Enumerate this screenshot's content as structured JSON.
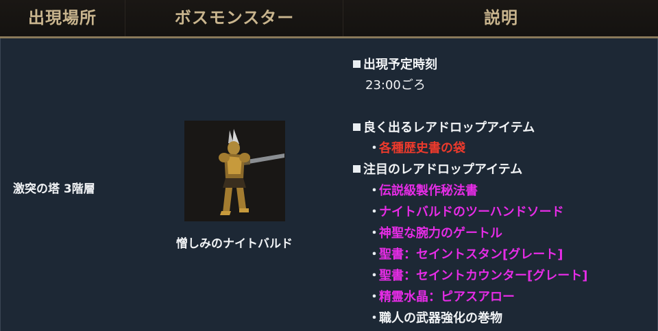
{
  "header": {
    "col_location": "出現場所",
    "col_boss": "ボスモンスター",
    "col_desc": "説明"
  },
  "row": {
    "location": "激突の塔 3階層",
    "boss_name": "憎しみのナイトバルド",
    "boss_image_icon": "knight-boss-portrait"
  },
  "description": {
    "time_heading": "出現予定時刻",
    "time_value": "23:00ごろ",
    "common_drop_heading": "良く出るレアドロップアイテム",
    "common_drops": [
      "各種歴史書の袋"
    ],
    "notable_drop_heading": "注目のレアドロップアイテム",
    "notable_drops": [
      "伝説級製作秘法書",
      "ナイトバルドのツーハンドソード",
      "神聖な腕力のゲートル",
      "聖書：セイントスタン[グレート]",
      "聖書：セイントカウンター[グレート]",
      "精霊水晶：ピアスアロー",
      "職人の武器強化の巻物"
    ]
  },
  "colors": {
    "header_text": "#c9b58e",
    "common_drop": "#ec3a2c",
    "notable_drop": "#e62ce6",
    "background": "#1d2835"
  }
}
